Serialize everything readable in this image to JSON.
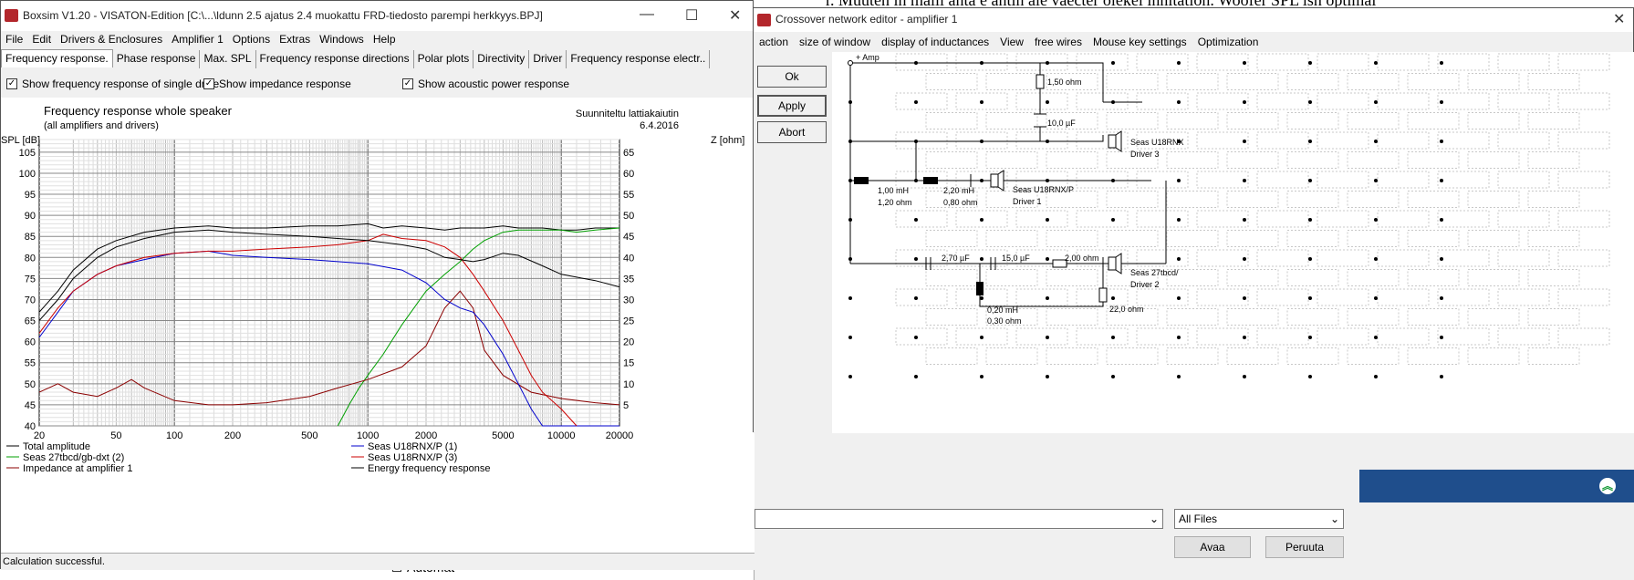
{
  "background": {
    "doc_text": "r. Muuten in malli anta e antin ale vaecter olekei innitation. Woofer SPL isn optimal",
    "dialog": {
      "filter_value": "All Files",
      "open_label": "Avaa",
      "cancel_label": "Peruuta",
      "sidebar_text": "Automat"
    },
    "colors": {
      "accent": "#1f4e8c"
    }
  },
  "boxsim": {
    "title": "Boxsim V1.20 - VISATON-Edition [C:\\...\\ldunn 2.5 ajatus 2.4 muokattu FRD-tiedosto parempi herkkyys.BPJ]",
    "menu": [
      "File",
      "Edit",
      "Drivers & Enclosures",
      "Amplifier 1",
      "Options",
      "Extras",
      "Windows",
      "Help"
    ],
    "tabs": [
      "Frequency response.",
      "Phase response",
      "Max. SPL",
      "Frequency response directions",
      "Polar plots",
      "Directivity",
      "Driver",
      "Frequency response electr.."
    ],
    "checks": [
      {
        "label": "Show frequency response of single drive",
        "checked": true
      },
      {
        "label": "Show impedance response",
        "checked": true
      },
      {
        "label": "Show acoustic power response",
        "checked": true
      }
    ],
    "status": "Calculation successful."
  },
  "chart_data": {
    "type": "line",
    "title": "Frequency response whole speaker",
    "subtitle": "(all amplifiers and drivers)",
    "annotation": [
      "Suunniteltu lattiakaiutin",
      "6.4.2016"
    ],
    "xlabel": "",
    "ylabel": "SPL [dB]",
    "y2label": "Z [ohm]",
    "xscale": "log",
    "xlim": [
      20,
      20000
    ],
    "ylim": [
      40,
      108
    ],
    "y2lim": [
      0,
      68
    ],
    "xticks": [
      20,
      50,
      100,
      200,
      500,
      1000,
      2000,
      5000,
      10000,
      20000
    ],
    "xtick_labels": [
      "20",
      "50",
      "100",
      "200",
      "500",
      "1000",
      "2000",
      "5000",
      "10000",
      "20000"
    ],
    "yticks": [
      40,
      45,
      50,
      55,
      60,
      65,
      70,
      75,
      80,
      85,
      90,
      95,
      100,
      105
    ],
    "y2ticks": [
      5,
      10,
      15,
      20,
      25,
      30,
      35,
      40,
      45,
      50,
      55,
      60,
      65
    ],
    "grid": true,
    "legend_position": "bottom",
    "series": [
      {
        "name": "Total amplitude",
        "color": "#000000",
        "axis": "left",
        "x": [
          20,
          25,
          30,
          40,
          50,
          70,
          100,
          150,
          200,
          300,
          500,
          700,
          1000,
          1200,
          1500,
          2000,
          2500,
          3000,
          4000,
          5000,
          6000,
          8000,
          10000,
          12000,
          15000,
          20000
        ],
        "y": [
          67,
          72,
          77,
          82,
          84,
          86,
          87,
          87.5,
          87,
          87,
          87.5,
          87.5,
          88,
          87,
          87.5,
          87,
          86.5,
          87,
          87,
          87.5,
          87,
          87,
          86.5,
          86.5,
          87,
          87
        ]
      },
      {
        "name": "Seas 27tbcd/gb-dxt (2)",
        "color": "#00a000",
        "axis": "left",
        "x": [
          700,
          800,
          900,
          1000,
          1200,
          1500,
          2000,
          2500,
          3000,
          3500,
          4000,
          5000,
          6000,
          7000,
          8000,
          10000,
          12000,
          15000,
          20000
        ],
        "y": [
          40,
          45,
          49,
          52,
          57,
          64,
          72,
          76,
          79,
          82,
          84,
          86,
          86.5,
          86.5,
          86.5,
          86.5,
          86,
          86.5,
          87
        ]
      },
      {
        "name": "Impedance at amplifier 1",
        "color": "#8b0000",
        "axis": "right",
        "x": [
          20,
          25,
          30,
          40,
          50,
          60,
          70,
          100,
          150,
          200,
          300,
          500,
          700,
          1000,
          1500,
          2000,
          2500,
          3000,
          3500,
          4000,
          5000,
          7000,
          10000,
          15000,
          20000
        ],
        "y": [
          8,
          10,
          8,
          7,
          9,
          11,
          9,
          6,
          5,
          5,
          5.5,
          7,
          9,
          11,
          14,
          19,
          28,
          32,
          28,
          18,
          12,
          8,
          6.5,
          5.5,
          5
        ]
      },
      {
        "name": "Seas U18RNX/P (1)",
        "color": "#0000cc",
        "axis": "left",
        "x": [
          20,
          25,
          30,
          40,
          50,
          70,
          100,
          150,
          200,
          300,
          500,
          700,
          1000,
          1500,
          2000,
          2500,
          3000,
          3500,
          4000,
          5000,
          6000,
          7000,
          8000,
          10000,
          20000
        ],
        "y": [
          61,
          67,
          72,
          76,
          78,
          79.5,
          81,
          81.5,
          80.5,
          80,
          79.5,
          79,
          78.5,
          77,
          74,
          70,
          68,
          67,
          64,
          57,
          50,
          44,
          40,
          40,
          40
        ]
      },
      {
        "name": "Seas U18RNX/P (3)",
        "color": "#cc0000",
        "axis": "left",
        "x": [
          20,
          25,
          30,
          40,
          50,
          70,
          100,
          150,
          200,
          300,
          500,
          700,
          1000,
          1200,
          1500,
          2000,
          2500,
          3000,
          3500,
          4000,
          5000,
          6000,
          7000,
          8000,
          10000,
          12000
        ],
        "y": [
          62,
          68,
          72,
          76,
          78,
          80,
          81,
          81.5,
          81.5,
          82,
          82.5,
          83,
          84,
          85.5,
          84.5,
          84,
          82.5,
          80,
          76,
          72,
          65,
          58,
          52,
          48,
          44,
          40
        ]
      },
      {
        "name": "Energy frequency response",
        "color": "#000000",
        "axis": "left",
        "x": [
          20,
          25,
          30,
          40,
          50,
          70,
          100,
          150,
          200,
          300,
          500,
          700,
          1000,
          1500,
          2000,
          2500,
          3000,
          3500,
          4000,
          5000,
          6000,
          8000,
          10000,
          15000,
          20000
        ],
        "y": [
          65,
          70,
          75,
          80,
          82.5,
          84.5,
          86,
          86.5,
          86,
          85.5,
          85,
          84.5,
          84,
          83,
          82,
          80,
          79.5,
          79,
          79.5,
          81,
          80.5,
          78,
          76,
          74.5,
          73
        ]
      }
    ],
    "legend": [
      {
        "label": "Total amplitude",
        "color": "#000000"
      },
      {
        "label": "Seas 27tbcd/gb-dxt (2)",
        "color": "#00a000"
      },
      {
        "label": "Impedance at amplifier 1",
        "color": "#8b0000"
      },
      {
        "label": "Seas U18RNX/P (1)",
        "color": "#0000cc"
      },
      {
        "label": "Seas U18RNX/P (3)",
        "color": "#cc0000"
      },
      {
        "label": "Energy frequency response",
        "color": "#000000"
      }
    ]
  },
  "crossover": {
    "title": "Crossover network editor - amplifier 1",
    "menu": [
      "action",
      "size of window",
      "display of inductances",
      "View",
      "free wires",
      "Mouse key settings",
      "Optimization"
    ],
    "buttons": {
      "ok": "Ok",
      "apply": "Apply",
      "abort": "Abort"
    },
    "amp_label": "+ Amp",
    "components": {
      "r1": "1,50 ohm",
      "c1": "10,0 µF",
      "l1": "1,00 mH",
      "l1r": "1,20 ohm",
      "l2": "2,20 mH",
      "l2r": "0,80 ohm",
      "c2": "2,70 µF",
      "c3": "15,0 µF",
      "r2": "2,00 ohm",
      "l3": "0,20 mH",
      "l3r": "0,30 ohm",
      "r3": "22,0 ohm"
    },
    "drivers": {
      "d3_name": "Seas U18RNX",
      "d3_label": "Driver 3",
      "d1_name": "Seas U18RNX/P",
      "d1_label": "Driver 1",
      "d2_name": "Seas 27tbcd/",
      "d2_label": "Driver 2"
    }
  }
}
